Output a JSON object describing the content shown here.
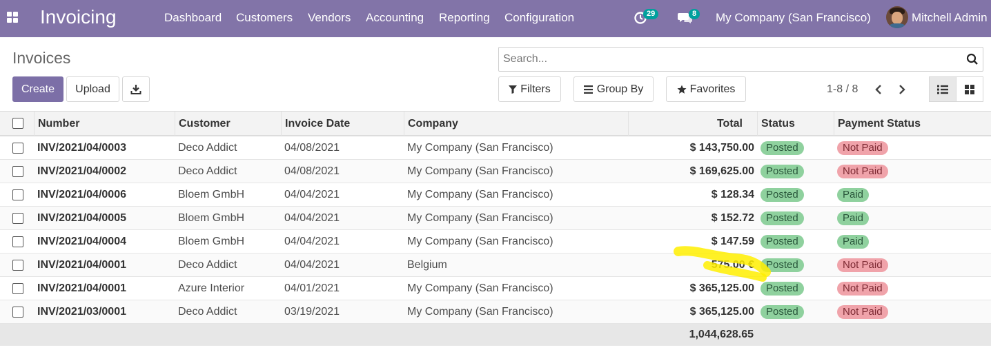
{
  "navbar": {
    "app_title": "Invoicing",
    "menu": [
      "Dashboard",
      "Customers",
      "Vendors",
      "Accounting",
      "Reporting",
      "Configuration"
    ],
    "activity_count": "29",
    "message_count": "8",
    "company": "My Company (San Francisco)",
    "user": "Mitchell Admin",
    "color": "#8274a8"
  },
  "control_panel": {
    "title": "Invoices",
    "create_label": "Create",
    "upload_label": "Upload",
    "search_placeholder": "Search...",
    "filters_label": "Filters",
    "group_by_label": "Group By",
    "favorites_label": "Favorites",
    "pager": "1-8 / 8",
    "primary_color": "#7c6fa7"
  },
  "table": {
    "columns": [
      "Number",
      "Customer",
      "Invoice Date",
      "Company",
      "Total",
      "Status",
      "Payment Status"
    ],
    "rows": [
      {
        "number": "INV/2021/04/0003",
        "customer": "Deco Addict",
        "date": "04/08/2021",
        "company": "My Company (San Francisco)",
        "total": "$ 143,750.00",
        "status": "Posted",
        "payment": "Not Paid"
      },
      {
        "number": "INV/2021/04/0002",
        "customer": "Deco Addict",
        "date": "04/08/2021",
        "company": "My Company (San Francisco)",
        "total": "$ 169,625.00",
        "status": "Posted",
        "payment": "Not Paid"
      },
      {
        "number": "INV/2021/04/0006",
        "customer": "Bloem GmbH",
        "date": "04/04/2021",
        "company": "My Company (San Francisco)",
        "total": "$ 128.34",
        "status": "Posted",
        "payment": "Paid"
      },
      {
        "number": "INV/2021/04/0005",
        "customer": "Bloem GmbH",
        "date": "04/04/2021",
        "company": "My Company (San Francisco)",
        "total": "$ 152.72",
        "status": "Posted",
        "payment": "Paid"
      },
      {
        "number": "INV/2021/04/0004",
        "customer": "Bloem GmbH",
        "date": "04/04/2021",
        "company": "My Company (San Francisco)",
        "total": "$ 147.59",
        "status": "Posted",
        "payment": "Paid"
      },
      {
        "number": "INV/2021/04/0001",
        "customer": "Deco Addict",
        "date": "04/04/2021",
        "company": "Belgium",
        "total": "575.00 €",
        "status": "Posted",
        "payment": "Not Paid"
      },
      {
        "number": "INV/2021/04/0001",
        "customer": "Azure Interior",
        "date": "04/01/2021",
        "company": "My Company (San Francisco)",
        "total": "$ 365,125.00",
        "status": "Posted",
        "payment": "Not Paid"
      },
      {
        "number": "INV/2021/03/0001",
        "customer": "Deco Addict",
        "date": "03/19/2021",
        "company": "My Company (San Francisco)",
        "total": "$ 365,125.00",
        "status": "Posted",
        "payment": "Not Paid"
      }
    ],
    "sum_total": "1,044,628.65"
  },
  "colors": {
    "posted": "#8fd19e",
    "not_paid": "#f0a3aa",
    "paid": "#8fd19e",
    "highlight": "#ffee00"
  }
}
